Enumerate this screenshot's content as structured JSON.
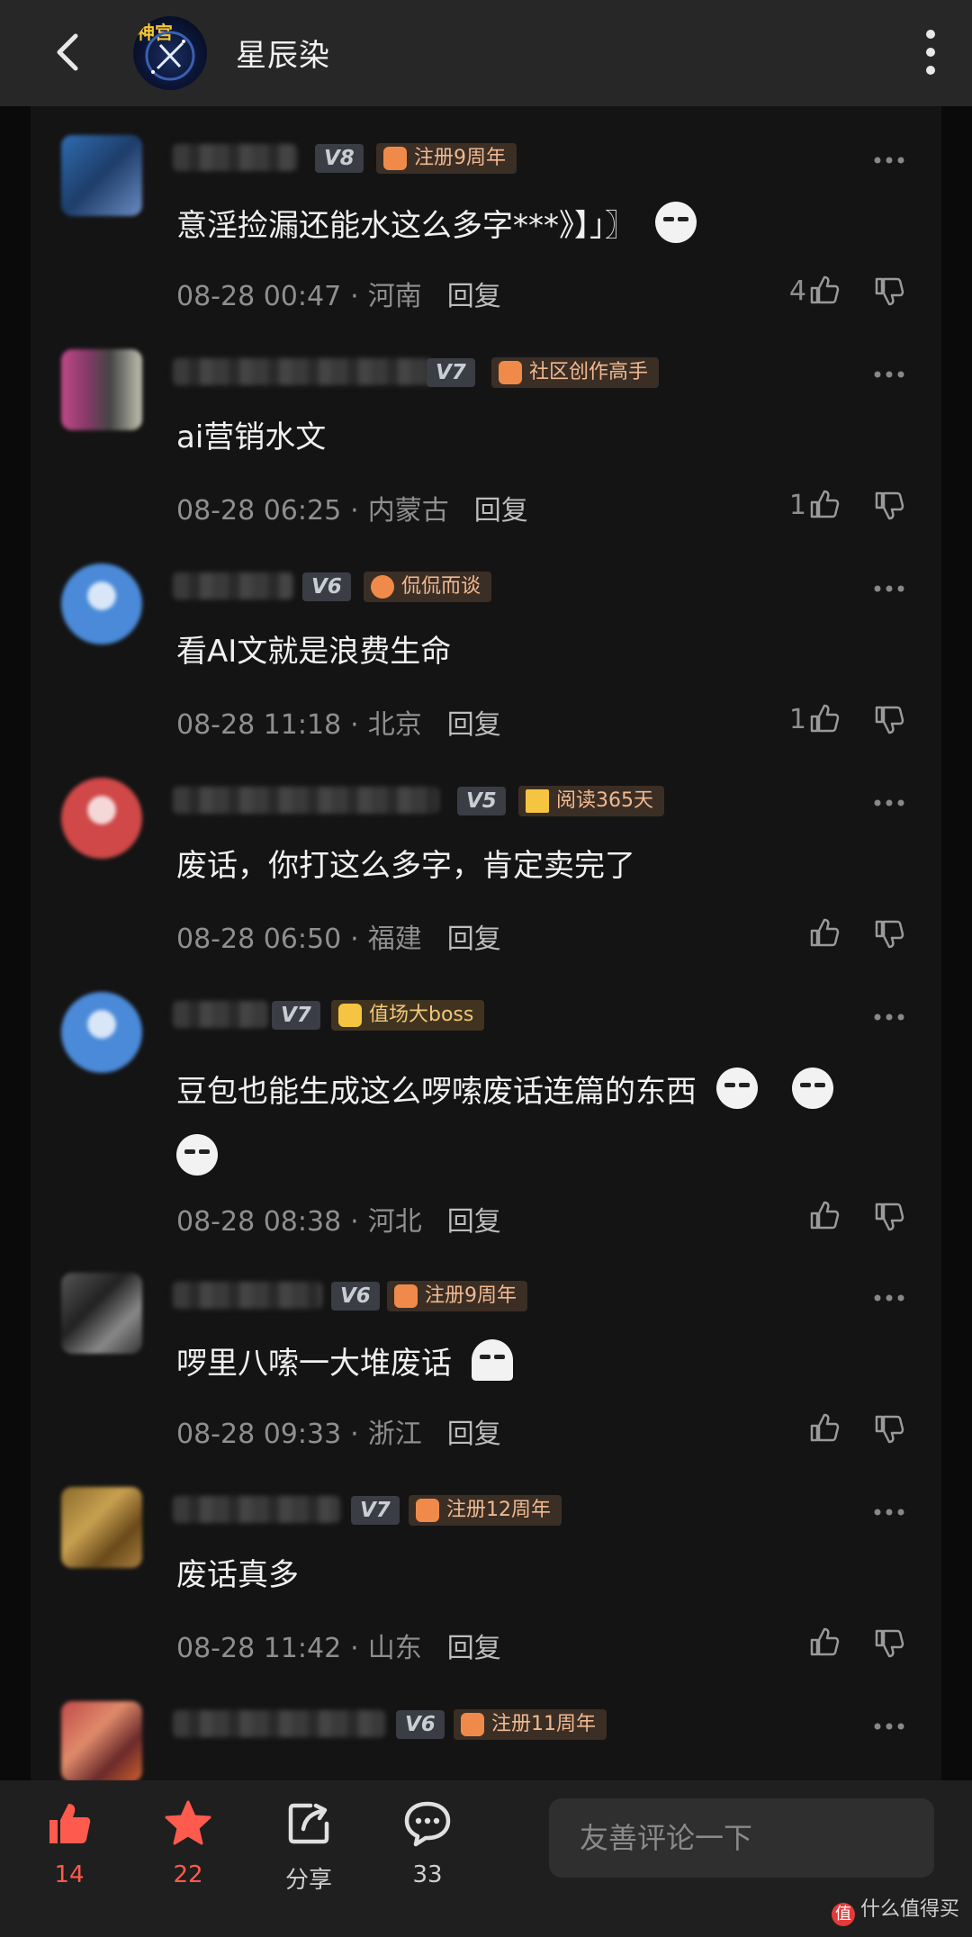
{
  "header": {
    "title": "星辰染",
    "avatar_logo_text": "神宫"
  },
  "comments": [
    {
      "level": "V8",
      "medal": "注册9周年",
      "medal_icon": "cake-icon",
      "text": "意淫捡漏还能水这么多字***》】」〗",
      "emojis": 1,
      "date": "08-28 00:47",
      "location": "河南",
      "reply": "回复",
      "likes": "4"
    },
    {
      "level": "V7",
      "medal": "社区创作高手",
      "medal_icon": "pen-icon",
      "text": "ai营销水文",
      "emojis": 0,
      "date": "08-28 06:25",
      "location": "内蒙古",
      "reply": "回复",
      "likes": "1"
    },
    {
      "level": "V6",
      "medal": "侃侃而谈",
      "medal_icon": "chat-icon",
      "text": "看AI文就是浪费生命",
      "emojis": 0,
      "date": "08-28 11:18",
      "location": "北京",
      "reply": "回复",
      "likes": "1"
    },
    {
      "level": "V5",
      "medal": "阅读365天",
      "medal_icon": "book-icon",
      "text": "废话，你打这么多字，肯定卖完了",
      "emojis": 0,
      "date": "08-28 06:50",
      "location": "福建",
      "reply": "回复",
      "likes": ""
    },
    {
      "level": "V7",
      "medal": "值场大boss",
      "medal_icon": "crown-icon",
      "text": "豆包也能生成这么啰嗦废话连篇的东西",
      "emojis": 3,
      "date": "08-28 08:38",
      "location": "河北",
      "reply": "回复",
      "likes": ""
    },
    {
      "level": "V6",
      "medal": "注册9周年",
      "medal_icon": "cake-icon",
      "text": "啰里八嗦一大堆废话",
      "emojis": 1,
      "date": "08-28 09:33",
      "location": "浙江",
      "reply": "回复",
      "likes": ""
    },
    {
      "level": "V7",
      "medal": "注册12周年",
      "medal_icon": "cake-icon",
      "text": "废话真多",
      "emojis": 0,
      "date": "08-28 11:42",
      "location": "山东",
      "reply": "回复",
      "likes": ""
    },
    {
      "level": "V6",
      "medal": "注册11周年",
      "medal_icon": "cake-icon"
    }
  ],
  "bottom_bar": {
    "like_count": "14",
    "favorite_count": "22",
    "share_label": "分享",
    "comment_count": "33",
    "comment_placeholder": "友善评论一下",
    "active_color": "#ff5a4e"
  },
  "watermark": "什么值得买"
}
